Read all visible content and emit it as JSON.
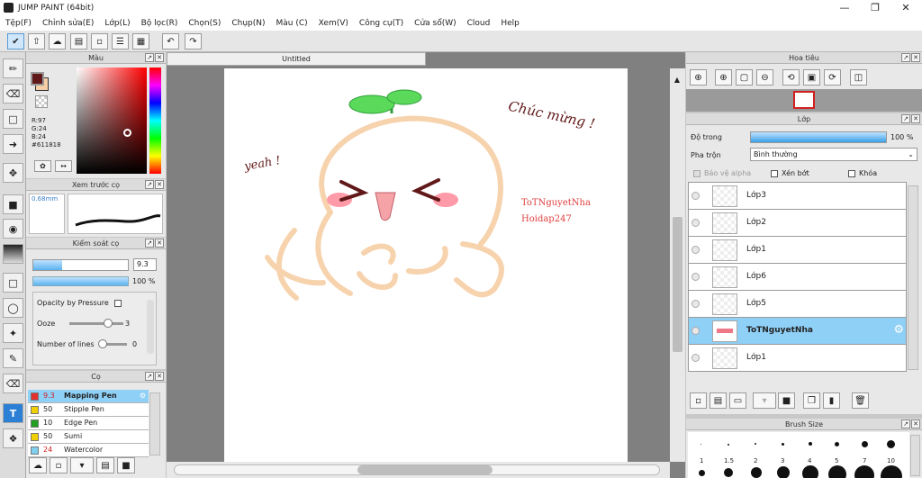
{
  "app": {
    "title": "JUMP PAINT (64bit)"
  },
  "menu": [
    "Tệp(F)",
    "Chỉnh sửa(E)",
    "Lớp(L)",
    "Bộ lọc(R)",
    "Chọn(S)",
    "Chụp(N)",
    "Màu (C)",
    "Xem(V)",
    "Công cụ(T)",
    "Cửa sổ(W)",
    "Cloud",
    "Help"
  ],
  "panels": {
    "color": {
      "title": "Màu",
      "r": "R:97",
      "g": "G:24",
      "b": "B:24",
      "hex": "#611818",
      "main": "#611818",
      "sub": "#f6cfa7"
    },
    "brush_preview": {
      "title": "Xem trước cọ",
      "size": "0.68mm"
    },
    "brush_control": {
      "title": "Kiểm soát cọ",
      "size_value": "9.3",
      "opacity_value": "100 %",
      "opacity_pressure": "Opacity by Pressure",
      "ooze_label": "Ooze",
      "ooze_value": "3",
      "lines_label": "Number of lines",
      "lines_value": "0",
      "ooze_level": 0.72,
      "lines_level": 0.1,
      "size_level": 0.3
    },
    "brushes": {
      "title": "Cọ",
      "items": [
        {
          "size": "9.3",
          "name": "Mapping Pen",
          "color": "#e03030",
          "selected": true
        },
        {
          "size": "50",
          "name": "Stipple Pen",
          "color": "#f0d000",
          "selected": false
        },
        {
          "size": "10",
          "name": "Edge Pen",
          "color": "#20a020",
          "selected": false
        },
        {
          "size": "50",
          "name": "Sumi",
          "color": "#f0d000",
          "selected": false
        },
        {
          "size": "24",
          "name": "Watercolor",
          "color": "#80d0f0",
          "selected": false
        }
      ]
    },
    "navigator": {
      "title": "Hoa tiêu"
    },
    "layers": {
      "title": "Lớp",
      "opacity_label": "Độ trong",
      "opacity_value": "100 %",
      "opacity_level": 1.0,
      "blend_label": "Pha trộn",
      "blend_value": "Bình thường",
      "protect_alpha": "Bảo vệ alpha",
      "clipping": "Xén bớt",
      "lock": "Khóa",
      "items": [
        {
          "name": "Lớp3",
          "selected": false
        },
        {
          "name": "Lớp2",
          "selected": false
        },
        {
          "name": "Lớp1",
          "selected": false
        },
        {
          "name": "Lớp6",
          "selected": false
        },
        {
          "name": "Lớp5",
          "selected": false
        },
        {
          "name": "ToTNguyetNha",
          "selected": true
        },
        {
          "name": "Lớp1",
          "selected": false
        }
      ]
    },
    "brush_size": {
      "title": "Brush Size",
      "sizes": [
        "1",
        "1.5",
        "2",
        "3",
        "4",
        "5",
        "7",
        "10"
      ]
    }
  },
  "document": {
    "tab": "Untitled"
  },
  "artwork": {
    "text_chuc_mung": "Chúc mừng !",
    "text_yeah": "yeah !",
    "watermark1": "ToTNguyetNha",
    "watermark2": "Hoidap247",
    "colors": {
      "outline": "#f7d3ad",
      "sprout": "#5ad95a",
      "blush": "#ff9aa8",
      "eyes": "#611818",
      "mouth": "#f6a3a8",
      "ink": "#611818",
      "wm": "#e04040"
    }
  }
}
